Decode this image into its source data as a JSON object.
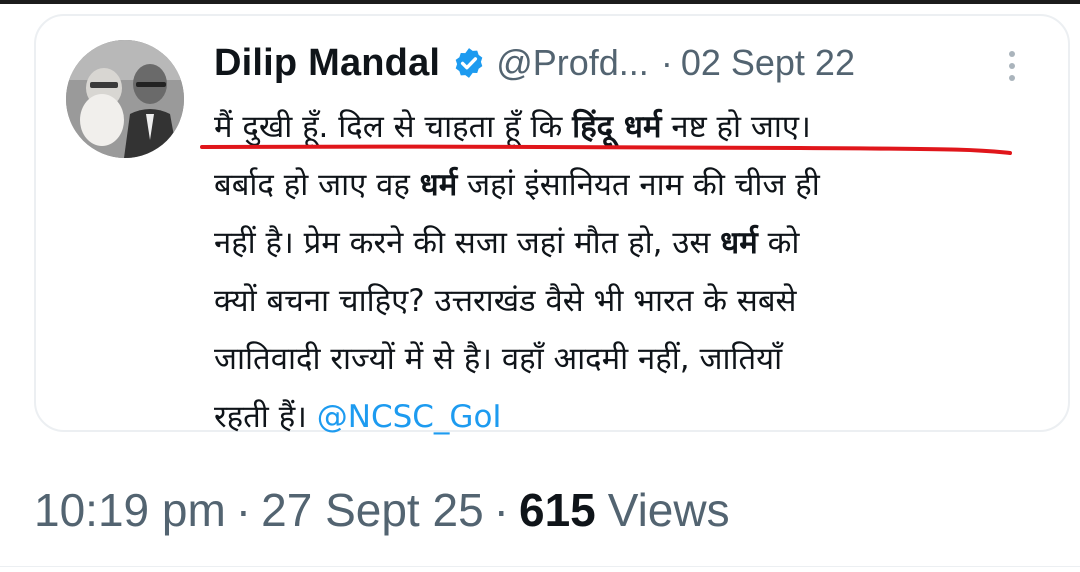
{
  "tweet": {
    "author_name": "Dilip Mandal",
    "handle": "@Profd...",
    "separator": "·",
    "date": "02 Sept 22",
    "text_lines": [
      [
        "मैं दुखी हूँ. दिल से चाहता हूँ कि ",
        "हिंदू धर्म",
        " नष्ट हो जाए।"
      ],
      [
        "बर्बाद हो जाए वह ",
        "धर्म",
        " जहां इंसानियत नाम की चीज ही"
      ],
      [
        "नहीं है। प्रेम करने की सजा जहां मौत हो, उस ",
        "धर्म",
        " को"
      ],
      [
        "क्यों बचना चाहिए? उत्तराखंड वैसे भी भारत के सबसे"
      ],
      [
        "जातिवादी राज्यों में से है। वहाँ आदमी नहीं, जातियाँ"
      ],
      [
        "रहती हैं। ",
        "@NCSC_GoI"
      ]
    ],
    "highlight_color": "#e0161b"
  },
  "post_meta": {
    "time": "10:19 pm",
    "separator": "·",
    "date": "27 Sept 25",
    "views_count": "615",
    "views_label": "Views"
  },
  "icons": {
    "avatar": "avatar-photo",
    "verified": "verified-badge-icon",
    "more": "more-vertical-icon"
  },
  "colors": {
    "text_primary": "#0f1419",
    "text_secondary": "#536471",
    "link": "#1d9bf0",
    "verified": "#1d9bf0",
    "card_border": "#eceff2"
  }
}
